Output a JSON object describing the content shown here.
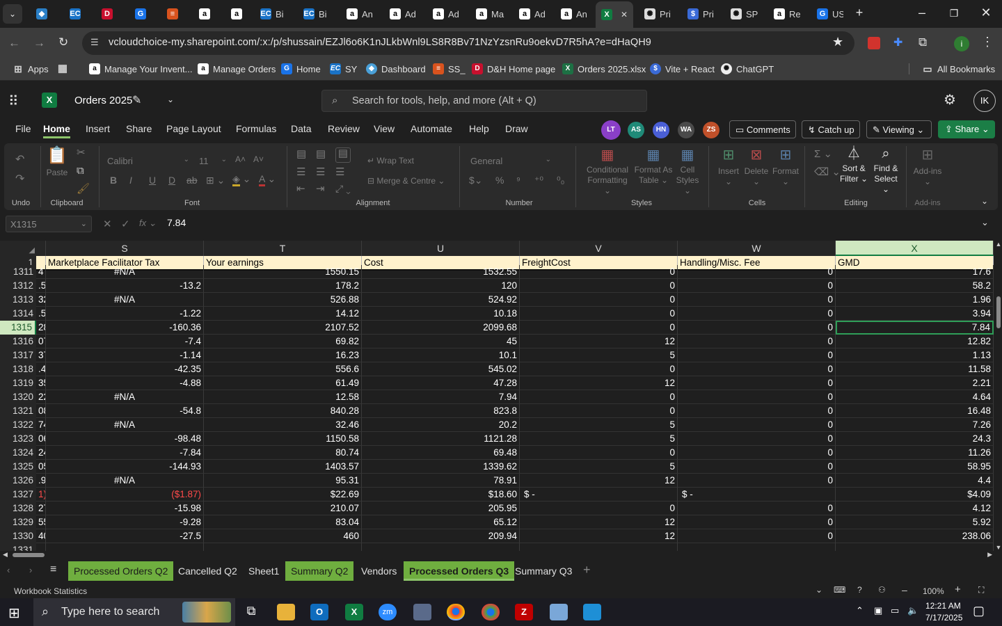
{
  "browser": {
    "tabs": [
      {
        "icon": "bc-icon",
        "label": ""
      },
      {
        "icon": "ec-icon",
        "label": ""
      },
      {
        "icon": "dh-icon",
        "label": ""
      },
      {
        "icon": "google-icon",
        "label": ""
      },
      {
        "icon": "ss-icon",
        "label": ""
      },
      {
        "icon": "amazon-icon",
        "label": ""
      },
      {
        "icon": "amazon-icon",
        "label": ""
      },
      {
        "icon": "ec-icon",
        "label": "Bi"
      },
      {
        "icon": "ec-icon",
        "label": "Bi"
      },
      {
        "icon": "amazon-icon",
        "label": "An"
      },
      {
        "icon": "amazon-icon",
        "label": "Ad"
      },
      {
        "icon": "amazon-icon",
        "label": "Ad"
      },
      {
        "icon": "amazon-icon",
        "label": "Ma"
      },
      {
        "icon": "amazon-icon",
        "label": "Ad"
      },
      {
        "icon": "amazon-icon",
        "label": "An"
      },
      {
        "icon": "excel-icon",
        "label": ""
      },
      {
        "icon": "chatgpt-icon",
        "label": "Pri"
      },
      {
        "icon": "vite-icon",
        "label": "Pri"
      },
      {
        "icon": "chatgpt-icon",
        "label": "SP"
      },
      {
        "icon": "amazon-icon",
        "label": "Re"
      },
      {
        "icon": "google-icon",
        "label": "US"
      }
    ],
    "url": "vcloudchoice-my.sharepoint.com/:x:/p/shussain/EZJl6o6K1nJLkbWnl9LS8R8Bv71NzYzsnRu9oekvD7R5hA?e=dHaQH9",
    "bookmarks": [
      "Apps",
      "Manage Your Invent...",
      "Manage Orders",
      "Home",
      "SY",
      "Dashboard",
      "SS_",
      "D&H Home page",
      "Orders 2025.xlsx",
      "Vite + React",
      "ChatGPT"
    ],
    "all_bookmarks": "All Bookmarks"
  },
  "excel": {
    "file_name": "Orders 2025",
    "search_placeholder": "Search for tools, help, and more (Alt + Q)",
    "user_initials": "IK",
    "ribbon_tabs": [
      "File",
      "Home",
      "Insert",
      "Share",
      "Page Layout",
      "Formulas",
      "Data",
      "Review",
      "View",
      "Automate",
      "Help",
      "Draw"
    ],
    "active_tab": "Home",
    "collaborators": [
      {
        "initials": "LT",
        "color": "#8a3fc8"
      },
      {
        "initials": "AS",
        "color": "#1f8a78"
      },
      {
        "initials": "HN",
        "color": "#4a5fd6"
      },
      {
        "initials": "WA",
        "color": "#4a4a4a"
      },
      {
        "initials": "ZS",
        "color": "#c0502a"
      }
    ],
    "comments_label": "Comments",
    "catchup_label": "Catch up",
    "viewing_label": "Viewing",
    "share_label": "Share",
    "ribbon": {
      "undo_group": "Undo",
      "clipboard_group": "Clipboard",
      "paste": "Paste",
      "font_group": "Font",
      "font_name": "Calibri",
      "font_size": "11",
      "alignment_group": "Alignment",
      "wrap_text": "Wrap Text",
      "merge_centre": "Merge & Centre",
      "number_group": "Number",
      "number_format": "General",
      "styles_group": "Styles",
      "conditional_formatting_1": "Conditional",
      "conditional_formatting_2": "Formatting",
      "format_as_table_1": "Format As",
      "format_as_table_2": "Table",
      "cell_styles_1": "Cell",
      "cell_styles_2": "Styles",
      "cells_group": "Cells",
      "insert": "Insert",
      "delete": "Delete",
      "format": "Format",
      "editing_group": "Editing",
      "sort_filter_1": "Sort &",
      "sort_filter_2": "Filter",
      "find_select_1": "Find &",
      "find_select_2": "Select",
      "addins_group": "Add-ins",
      "addins": "Add-ins"
    },
    "name_box": "X1315",
    "formula_value": "7.84",
    "columns": [
      {
        "letter": "S",
        "header": "Marketplace Facilitator Tax"
      },
      {
        "letter": "T",
        "header": "Your earnings"
      },
      {
        "letter": "U",
        "header": "Cost"
      },
      {
        "letter": "V",
        "header": "FreightCost"
      },
      {
        "letter": "W",
        "header": "Handling/Misc. Fee"
      },
      {
        "letter": "X",
        "header": "GMD"
      }
    ],
    "header_row": "1",
    "rows": [
      {
        "n": "1311",
        "r": "4",
        "s": "#N/A",
        "t": "1550.15",
        "u": "1532.55",
        "v": "0",
        "w": "0",
        "x": "17.6"
      },
      {
        "n": "1312",
        "r": ".5",
        "s": "-13.2",
        "t": "178.2",
        "u": "120",
        "v": "0",
        "w": "0",
        "x": "58.2"
      },
      {
        "n": "1313",
        "r": "32",
        "s": "#N/A",
        "t": "526.88",
        "u": "524.92",
        "v": "0",
        "w": "0",
        "x": "1.96"
      },
      {
        "n": "1314",
        "r": ".5",
        "s": "-1.22",
        "t": "14.12",
        "u": "10.18",
        "v": "0",
        "w": "0",
        "x": "3.94"
      },
      {
        "n": "1315",
        "r": "28",
        "s": "-160.36",
        "t": "2107.52",
        "u": "2099.68",
        "v": "0",
        "w": "0",
        "x": "7.84"
      },
      {
        "n": "1316",
        "r": "07",
        "s": "-7.4",
        "t": "69.82",
        "u": "45",
        "v": "12",
        "w": "0",
        "x": "12.82"
      },
      {
        "n": "1317",
        "r": "37",
        "s": "-1.14",
        "t": "16.23",
        "u": "10.1",
        "v": "5",
        "w": "0",
        "x": "1.13"
      },
      {
        "n": "1318",
        "r": ".4",
        "s": "-42.35",
        "t": "556.6",
        "u": "545.02",
        "v": "0",
        "w": "0",
        "x": "11.58"
      },
      {
        "n": "1319",
        "r": "35",
        "s": "-4.88",
        "t": "61.49",
        "u": "47.28",
        "v": "12",
        "w": "0",
        "x": "2.21"
      },
      {
        "n": "1320",
        "r": "22",
        "s": "#N/A",
        "t": "12.58",
        "u": "7.94",
        "v": "0",
        "w": "0",
        "x": "4.64"
      },
      {
        "n": "1321",
        "r": "08",
        "s": "-54.8",
        "t": "840.28",
        "u": "823.8",
        "v": "0",
        "w": "0",
        "x": "16.48"
      },
      {
        "n": "1322",
        "r": "74",
        "s": "#N/A",
        "t": "32.46",
        "u": "20.2",
        "v": "5",
        "w": "0",
        "x": "7.26"
      },
      {
        "n": "1323",
        "r": "06",
        "s": "-98.48",
        "t": "1150.58",
        "u": "1121.28",
        "v": "5",
        "w": "0",
        "x": "24.3"
      },
      {
        "n": "1324",
        "r": "24",
        "s": "-7.84",
        "t": "80.74",
        "u": "69.48",
        "v": "0",
        "w": "0",
        "x": "11.26"
      },
      {
        "n": "1325",
        "r": "05",
        "s": "-144.93",
        "t": "1403.57",
        "u": "1339.62",
        "v": "5",
        "w": "0",
        "x": "58.95"
      },
      {
        "n": "1326",
        "r": ".9",
        "s": "#N/A",
        "t": "95.31",
        "u": "78.91",
        "v": "12",
        "w": "0",
        "x": "4.4"
      },
      {
        "n": "1327",
        "r": "1)",
        "s": "($1.87)",
        "t": "$22.69",
        "u": "$18.60",
        "v": "$     -",
        "w": "$     -",
        "x": "$4.09"
      },
      {
        "n": "1328",
        "r": "27",
        "s": "-15.98",
        "t": "210.07",
        "u": "205.95",
        "v": "0",
        "w": "0",
        "x": "4.12"
      },
      {
        "n": "1329",
        "r": "55",
        "s": "-9.28",
        "t": "83.04",
        "u": "65.12",
        "v": "12",
        "w": "0",
        "x": "5.92"
      },
      {
        "n": "1330",
        "r": "40",
        "s": "-27.5",
        "t": "460",
        "u": "209.94",
        "v": "12",
        "w": "0",
        "x": "238.06"
      },
      {
        "n": "1331",
        "r": "",
        "s": "",
        "t": "",
        "u": "",
        "v": "",
        "w": "",
        "x": ""
      }
    ],
    "sheets": [
      {
        "name": "Processed Orders Q2",
        "green": true
      },
      {
        "name": "Cancelled Q2",
        "green": false
      },
      {
        "name": "Sheet1",
        "green": false
      },
      {
        "name": "Summary Q2",
        "green": true
      },
      {
        "name": "Vendors",
        "green": false
      },
      {
        "name": "Processed Orders Q3",
        "green": true
      },
      {
        "name": "Summary Q3",
        "green": false
      }
    ],
    "active_sheet": "Processed Orders Q3",
    "status_left": "Workbook Statistics",
    "zoom": "100%"
  },
  "taskbar": {
    "search_placeholder": "Type here to search",
    "time": "12:21 AM",
    "date": "7/17/2025"
  }
}
